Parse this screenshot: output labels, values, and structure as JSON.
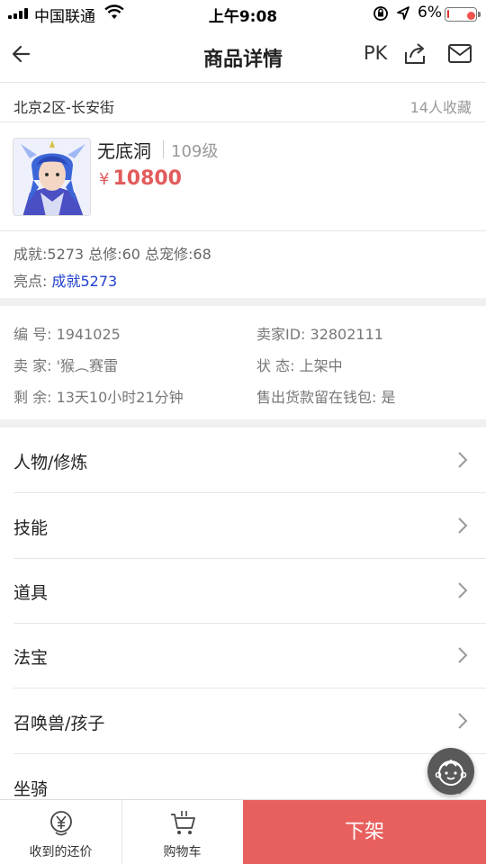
{
  "status_bar": {
    "carrier": "中国联通",
    "time": "上午9:08",
    "battery_pct": "6%",
    "battery_level": 0.06
  },
  "nav": {
    "title": "商品详情",
    "pk_label": "PK"
  },
  "location": {
    "server": "北京2区-长安街",
    "favorites": "14人收藏"
  },
  "item": {
    "name": "无底洞",
    "level": "109级",
    "currency": "¥",
    "price": "10800"
  },
  "stats": {
    "line": "成就:5273 总修:60 总宠修:68",
    "highlight_label": "亮点:",
    "highlight_value": "成就5273"
  },
  "info": {
    "id": "编  号: 1941025",
    "seller_id": "卖家ID: 32802111",
    "seller": "卖  家: '猴︵赛雷",
    "status": "状  态: 上架中",
    "remaining": "剩  余: 13天10小时21分钟",
    "wallet": "售出货款留在钱包: 是"
  },
  "menu": [
    {
      "label": "人物/修炼"
    },
    {
      "label": "技能"
    },
    {
      "label": "道具"
    },
    {
      "label": "法宝"
    },
    {
      "label": "召唤兽/孩子"
    },
    {
      "label": "坐骑"
    }
  ],
  "bottom_bar": {
    "offers_label": "收到的还价",
    "cart_label": "购物车",
    "action_label": "下架"
  },
  "colors": {
    "accent_red": "#e8605e",
    "price_red": "#e25b5b",
    "highlight_blue": "#1f3fcf"
  },
  "icons": [
    "back-arrow-icon",
    "share-icon",
    "mail-icon",
    "chevron-right-icon",
    "yen-coin-icon",
    "cart-icon",
    "assistant-face-icon"
  ]
}
